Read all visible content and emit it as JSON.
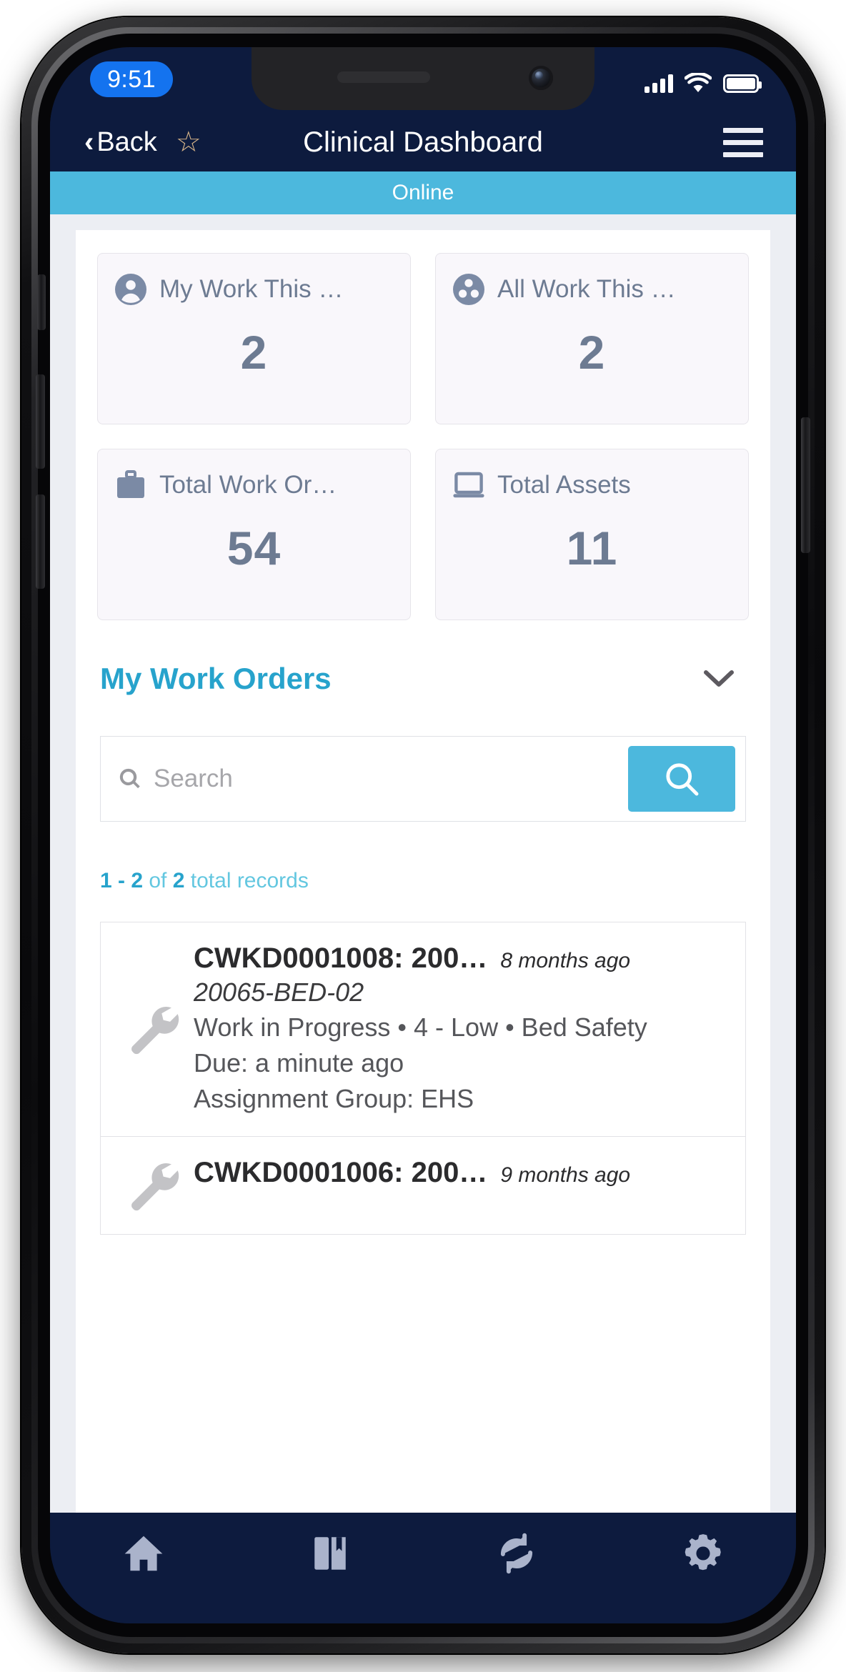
{
  "status_bar": {
    "time": "9:51",
    "signal_icon": "cellular-signal-icon",
    "wifi_icon": "wifi-icon",
    "battery_icon": "battery-full-icon"
  },
  "header": {
    "back_label": "Back",
    "back_chevron": "‹",
    "favorite_icon": "☆",
    "title": "Clinical Dashboard",
    "menu_icon": "hamburger-menu-icon"
  },
  "connection_banner": {
    "label": "Online",
    "color": "#4cb8dd"
  },
  "kpis": [
    {
      "icon": "user-icon",
      "label": "My Work This …",
      "value": "2"
    },
    {
      "icon": "group-icon",
      "label": "All Work This …",
      "value": "2"
    },
    {
      "icon": "briefcase-icon",
      "label": "Total Work Or…",
      "value": "54"
    },
    {
      "icon": "laptop-icon",
      "label": "Total Assets",
      "value": "11"
    }
  ],
  "section": {
    "title": "My Work Orders",
    "collapse_icon": "chevron-down-icon",
    "accent_color": "#27a3cc"
  },
  "search": {
    "placeholder": "Search",
    "value": "",
    "field_icon": "search-icon",
    "button_icon": "search-icon",
    "button_color": "#4cb8dd"
  },
  "records": {
    "range": "1 - 2",
    "of_label": "of",
    "total": "2",
    "suffix": "total records"
  },
  "work_orders": [
    {
      "icon": "wrench-icon",
      "number": "CWKD0001008: 200…",
      "age": "8 months ago",
      "asset": "20065-BED-02",
      "state_line": "Work in Progress • 4 - Low • Bed Safety",
      "due": "Due: a minute ago",
      "assignment_group": "Assignment Group: EHS"
    },
    {
      "icon": "wrench-icon",
      "number": "CWKD0001006: 200…",
      "age": "9 months ago",
      "asset": "",
      "state_line": "",
      "due": "",
      "assignment_group": ""
    }
  ],
  "tab_bar": [
    {
      "icon": "home-icon",
      "name": "home"
    },
    {
      "icon": "book-icon",
      "name": "library"
    },
    {
      "icon": "sync-icon",
      "name": "sync"
    },
    {
      "icon": "gear-icon",
      "name": "settings"
    }
  ]
}
